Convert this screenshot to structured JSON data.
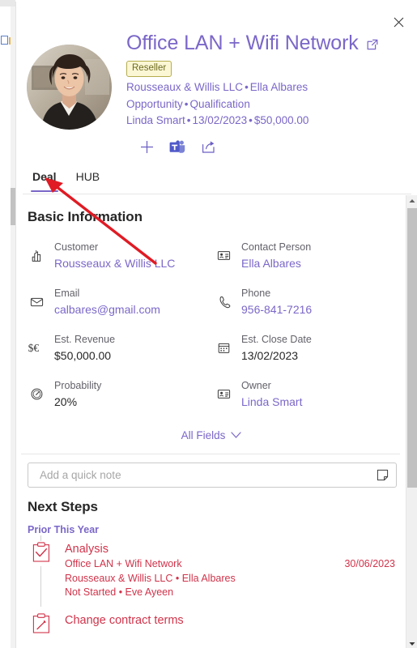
{
  "window": {
    "close_label": "Close",
    "popout_label": "Open in new window"
  },
  "header": {
    "title": "Office LAN + Wifi Network",
    "badge": "Reseller",
    "meta_line1_account": "Rousseaux & Willis LLC",
    "meta_line1_contact": "Ella Albares",
    "meta_line2_type": "Opportunity",
    "meta_line2_stage": "Qualification",
    "meta_line3_owner": "Linda Smart",
    "meta_line3_date": "13/02/2023",
    "meta_line3_amount": "$50,000.00",
    "separator": "•",
    "actions": [
      {
        "name": "add-button",
        "label": "Add"
      },
      {
        "name": "teams-button",
        "label": "Microsoft Teams"
      },
      {
        "name": "share-button",
        "label": "Share"
      }
    ]
  },
  "tabs": [
    {
      "label": "Deal",
      "active": true
    },
    {
      "label": "HUB",
      "active": false
    }
  ],
  "basic_information": {
    "section_title": "Basic Information",
    "fields": [
      {
        "icon": "building-icon",
        "label": "Customer",
        "value": "Rousseaux & Willis LLC",
        "link": true
      },
      {
        "icon": "contact-card-icon",
        "label": "Contact Person",
        "value": "Ella Albares",
        "link": true
      },
      {
        "icon": "envelope-icon",
        "label": "Email",
        "value": "calbares@gmail.com",
        "link": true
      },
      {
        "icon": "phone-icon",
        "label": "Phone",
        "value": "956-841-7216",
        "link": true
      },
      {
        "icon": "currency-icon",
        "label": "Est. Revenue",
        "value": "$50,000.00",
        "link": false
      },
      {
        "icon": "calendar-icon",
        "label": "Est. Close Date",
        "value": "13/02/2023",
        "link": false
      },
      {
        "icon": "gauge-icon",
        "label": "Probability",
        "value": "20%",
        "link": false
      },
      {
        "icon": "contact-card-icon",
        "label": "Owner",
        "value": "Linda Smart",
        "link": true
      }
    ],
    "all_fields_label": "All Fields"
  },
  "quick_note": {
    "placeholder": "Add a quick note",
    "value": ""
  },
  "next_steps": {
    "section_title": "Next Steps",
    "group_label": "Prior This Year",
    "tasks": [
      {
        "name": "Analysis",
        "related": "Office LAN + Wifi Network",
        "account": "Rousseaux & Willis LLC • Ella Albares",
        "status": "Not Started • Eve Ayeen",
        "date": "30/06/2023",
        "icon": "clipboard-check-icon"
      },
      {
        "name": "Change contract terms",
        "related": "",
        "account": "",
        "status": "",
        "date": "",
        "icon": "clipboard-edit-icon"
      }
    ]
  },
  "colors": {
    "accent_purple": "#7b67c8",
    "overdue_red": "#d0334a",
    "badge_bg": "#fbf7d5",
    "badge_border": "#b5ad4e",
    "badge_text": "#6d6a1e",
    "label_gray": "#62626a",
    "annotation_red": "#e01b24"
  }
}
